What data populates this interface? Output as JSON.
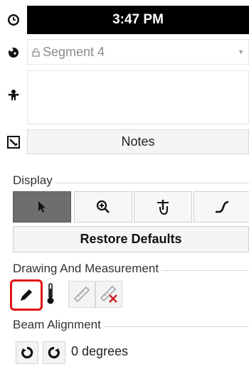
{
  "status": {
    "time": "3:47 PM"
  },
  "segment": {
    "selected": "Segment 4"
  },
  "notes_button": {
    "label": "Notes"
  },
  "display": {
    "title": "Display",
    "tools": [
      {
        "name": "pointer",
        "icon": "arrow-cursor-icon",
        "active": true
      },
      {
        "name": "zoom",
        "icon": "zoom-in-icon",
        "active": false
      },
      {
        "name": "touch",
        "icon": "touch-gesture-icon",
        "active": false
      },
      {
        "name": "curve",
        "icon": "curve-tool-icon",
        "active": false
      }
    ],
    "restore_label": "Restore Defaults"
  },
  "drawing": {
    "title": "Drawing And Measurement",
    "tools": [
      "pencil-icon",
      "thermometer-icon",
      "ruler-icon",
      "ruler-delete-icon"
    ]
  },
  "beam": {
    "title": "Beam Alignment",
    "value": "0 degrees"
  },
  "colors": {
    "active_tool": "#6e6e6e",
    "highlight": "#e01313",
    "time_bar": "#000000"
  }
}
